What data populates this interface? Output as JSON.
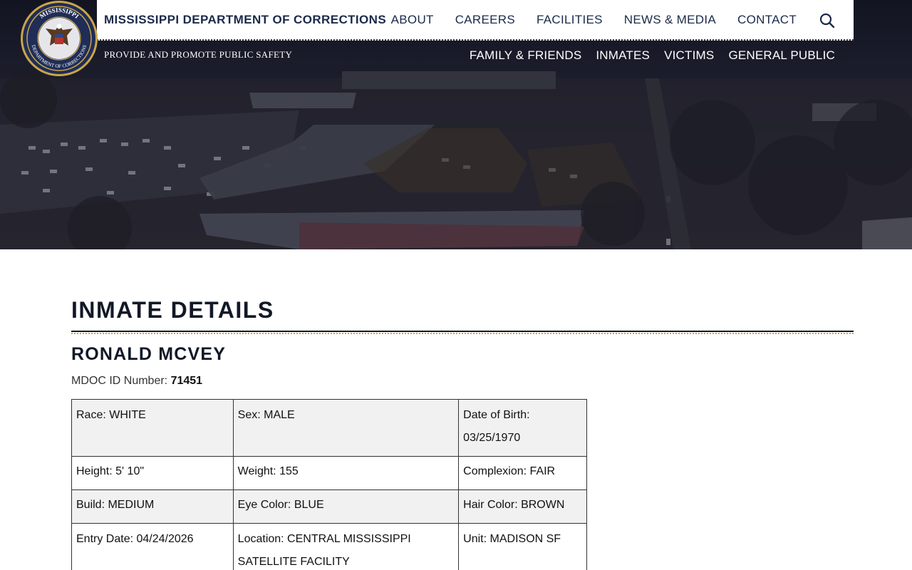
{
  "header": {
    "agency_name": "MISSISSIPPI DEPARTMENT OF CORRECTIONS",
    "tagline": "PROVIDE AND PROMOTE PUBLIC SAFETY",
    "top_nav": [
      "ABOUT",
      "CAREERS",
      "FACILITIES",
      "NEWS & MEDIA",
      "CONTACT"
    ],
    "sub_nav": [
      "FAMILY & FRIENDS",
      "INMATES",
      "VICTIMS",
      "GENERAL PUBLIC"
    ],
    "logo_text_top": "MISSISSIPPI",
    "logo_text_bottom": "DEPARTMENT OF CORRECTIONS"
  },
  "main": {
    "page_title": "INMATE DETAILS",
    "inmate_name": "RONALD MCVEY",
    "mdoc_label": "MDOC ID Number:",
    "mdoc_id": "71451",
    "details": [
      [
        "Race: WHITE",
        "Sex: MALE",
        "Date of Birth: 03/25/1970"
      ],
      [
        "Height: 5' 10\"",
        "Weight: 155",
        "Complexion: FAIR"
      ],
      [
        "Build: MEDIUM",
        "Eye Color: BLUE",
        "Hair Color: BROWN"
      ],
      [
        "Entry Date: 04/24/2026",
        "Location: CENTRAL MISSISSIPPI SATELLITE FACILITY",
        "Unit: MADISON SF"
      ]
    ]
  },
  "colors": {
    "navy": "#1b2a4a",
    "gold": "#c9a54a",
    "table_alt_row": "#f1f1f1"
  },
  "icons": [
    "search-icon",
    "agency-seal-logo"
  ]
}
